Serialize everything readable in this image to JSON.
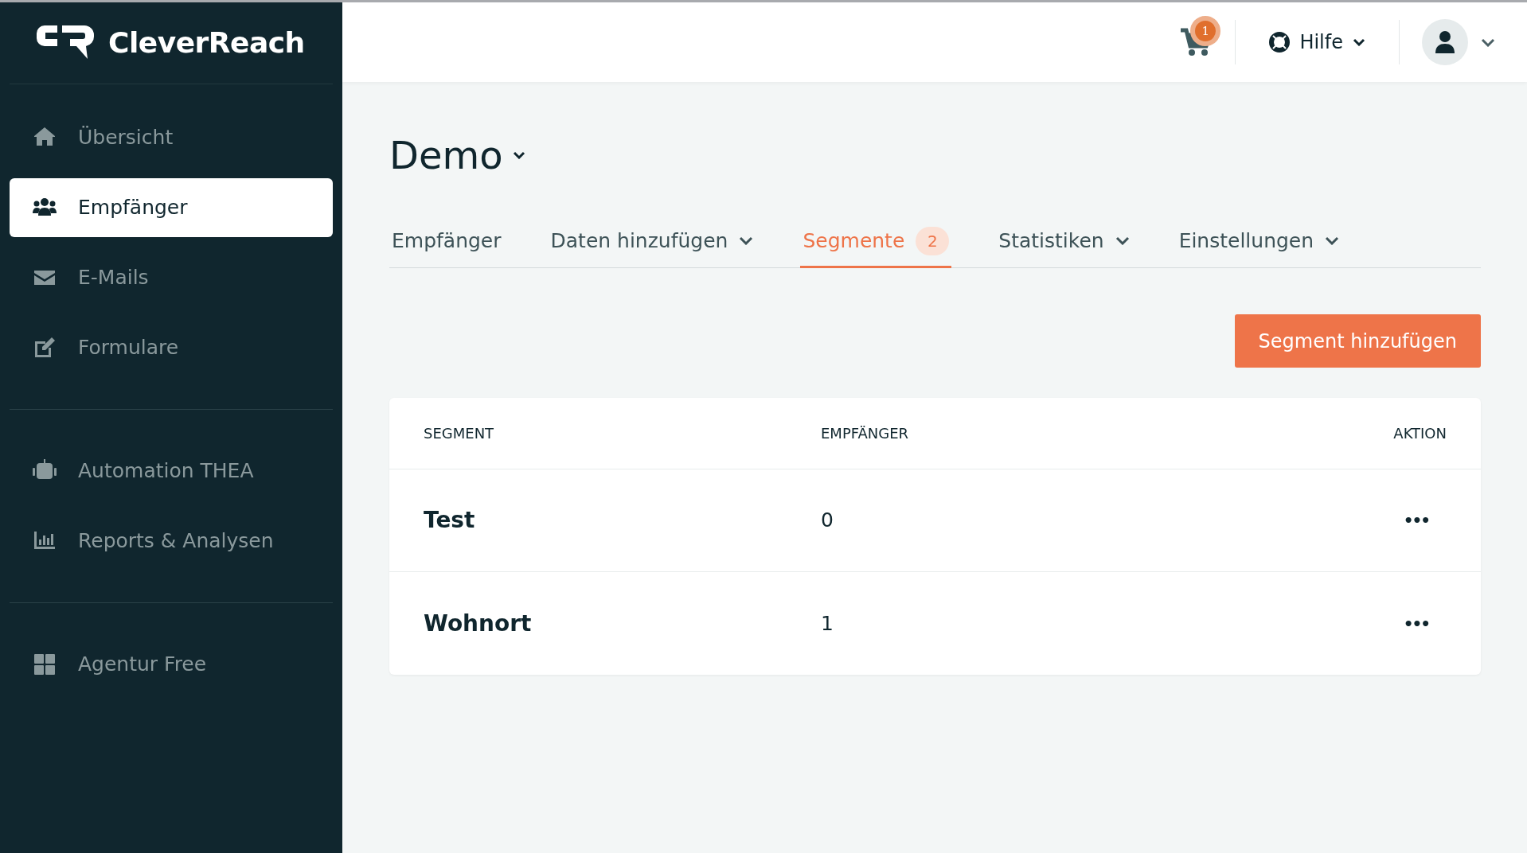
{
  "logo": {
    "text": "CleverReach"
  },
  "sidebar": {
    "sections": [
      {
        "items": [
          {
            "label": "Übersicht",
            "kind": "home",
            "selected": false
          },
          {
            "label": "Empfänger",
            "kind": "users",
            "selected": true
          },
          {
            "label": "E-Mails",
            "kind": "mail",
            "selected": false
          },
          {
            "label": "Formulare",
            "kind": "edit",
            "selected": false
          }
        ]
      },
      {
        "items": [
          {
            "label": "Automation THEA",
            "kind": "robot",
            "selected": false
          },
          {
            "label": "Reports & Analysen",
            "kind": "chart",
            "selected": false
          }
        ]
      },
      {
        "items": [
          {
            "label": "Agentur Free",
            "kind": "grid",
            "selected": false
          }
        ]
      }
    ]
  },
  "header": {
    "cart_badge": "1",
    "help": "Hilfe"
  },
  "page": {
    "title": "Demo"
  },
  "tabs": [
    {
      "label": "Empfänger",
      "selected": false,
      "dropdown": false
    },
    {
      "label": "Daten hinzufügen",
      "selected": false,
      "dropdown": true
    },
    {
      "label": "Segmente",
      "selected": true,
      "dropdown": false,
      "badge": "2"
    },
    {
      "label": "Statistiken",
      "selected": false,
      "dropdown": true
    },
    {
      "label": "Einstellungen",
      "selected": false,
      "dropdown": true
    }
  ],
  "add_button": "Segment hinzufügen",
  "table": {
    "columns": [
      "SEGMENT",
      "EMPFÄNGER",
      "AKTION"
    ],
    "rows": [
      {
        "segment": "Test",
        "recipients": "0",
        "action": "•••"
      },
      {
        "segment": "Wohnort",
        "recipients": "1",
        "action": "•••"
      }
    ]
  }
}
